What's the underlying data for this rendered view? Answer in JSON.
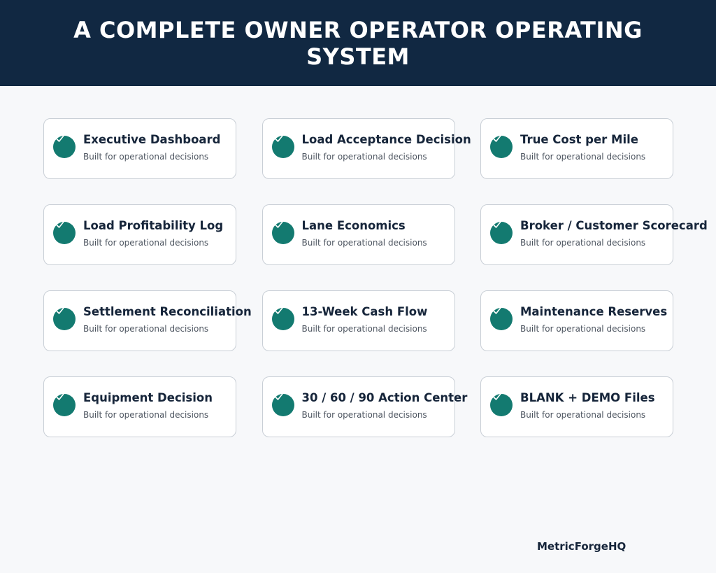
{
  "header": {
    "title": "A COMPLETE OWNER OPERATOR OPERATING SYSTEM"
  },
  "colors": {
    "header_bg": "#112842",
    "accent": "#137a70",
    "page_bg": "#f7f8fa",
    "title_text": "#16253a"
  },
  "cards": [
    {
      "title": "Executive Dashboard",
      "subtitle": "Built for operational decisions",
      "icon": "check-circle-icon"
    },
    {
      "title": "Load Acceptance Decision",
      "subtitle": "Built for operational decisions",
      "icon": "check-circle-icon"
    },
    {
      "title": "True Cost per Mile",
      "subtitle": "Built for operational decisions",
      "icon": "check-circle-icon"
    },
    {
      "title": "Load Profitability Log",
      "subtitle": "Built for operational decisions",
      "icon": "check-circle-icon"
    },
    {
      "title": "Lane Economics",
      "subtitle": "Built for operational decisions",
      "icon": "check-circle-icon"
    },
    {
      "title": "Broker / Customer Scorecard",
      "subtitle": "Built for operational decisions",
      "icon": "check-circle-icon"
    },
    {
      "title": "Settlement Reconciliation",
      "subtitle": "Built for operational decisions",
      "icon": "check-circle-icon"
    },
    {
      "title": "13-Week Cash Flow",
      "subtitle": "Built for operational decisions",
      "icon": "check-circle-icon"
    },
    {
      "title": "Maintenance Reserves",
      "subtitle": "Built for operational decisions",
      "icon": "check-circle-icon"
    },
    {
      "title": "Equipment Decision",
      "subtitle": "Built for operational decisions",
      "icon": "check-circle-icon"
    },
    {
      "title": "30 / 60 / 90 Action Center",
      "subtitle": "Built for operational decisions",
      "icon": "check-circle-icon"
    },
    {
      "title": "BLANK + DEMO Files",
      "subtitle": "Built for operational decisions",
      "icon": "check-circle-icon"
    }
  ],
  "footer": {
    "brand": "MetricForgeHQ"
  }
}
